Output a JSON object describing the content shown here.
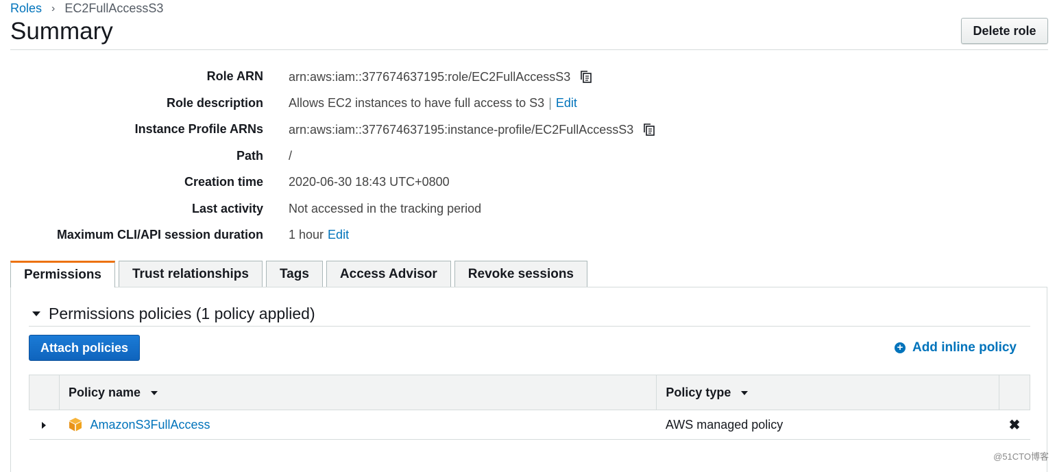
{
  "breadcrumb": {
    "parent": "Roles",
    "separator": "›",
    "current": "EC2FullAccessS3"
  },
  "page": {
    "title": "Summary",
    "delete_button": "Delete role"
  },
  "summary": {
    "rows": [
      {
        "label": "Role ARN",
        "value": "arn:aws:iam::377674637195:role/EC2FullAccessS3",
        "has_copy": true
      },
      {
        "label": "Role description",
        "value": "Allows EC2 instances to have full access to S3",
        "separator": "|",
        "link": "Edit"
      },
      {
        "label": "Instance Profile ARNs",
        "value": "arn:aws:iam::377674637195:instance-profile/EC2FullAccessS3",
        "has_copy": true
      },
      {
        "label": "Path",
        "value": "/"
      },
      {
        "label": "Creation time",
        "value": "2020-06-30 18:43 UTC+0800"
      },
      {
        "label": "Last activity",
        "value": "Not accessed in the tracking period"
      },
      {
        "label": "Maximum CLI/API session duration",
        "value": "1 hour",
        "link": "Edit"
      }
    ]
  },
  "tabs": [
    {
      "label": "Permissions",
      "active": true
    },
    {
      "label": "Trust relationships",
      "active": false
    },
    {
      "label": "Tags",
      "active": false
    },
    {
      "label": "Access Advisor",
      "active": false
    },
    {
      "label": "Revoke sessions",
      "active": false
    }
  ],
  "permissions": {
    "section_title": "Permissions policies (1 policy applied)",
    "attach_button": "Attach policies",
    "add_inline_link": "Add inline policy",
    "table": {
      "columns": [
        "Policy name",
        "Policy type"
      ],
      "rows": [
        {
          "name": "AmazonS3FullAccess",
          "type": "AWS managed policy"
        }
      ]
    }
  },
  "watermark": "@51CTO博客",
  "colors": {
    "link": "#0073bb",
    "accent_tab": "#ec7211",
    "primary_button": "#0f64bd",
    "policy_icon": "#f0a21c"
  }
}
